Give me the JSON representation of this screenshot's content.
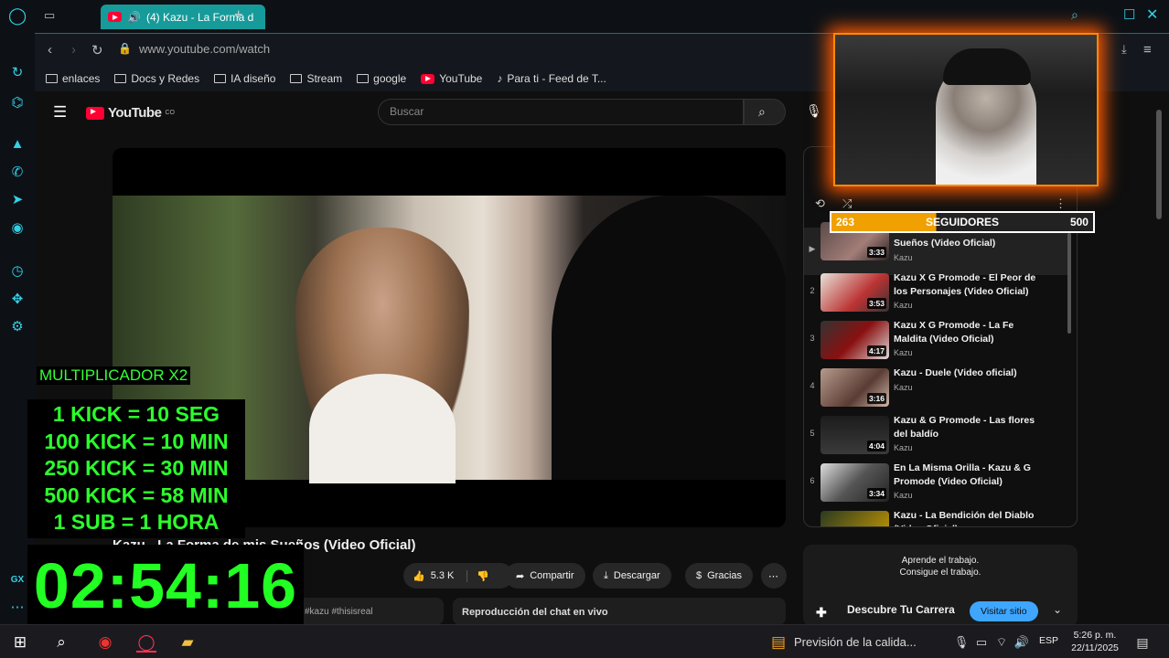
{
  "browser": {
    "tab": {
      "title": "(4) Kazu - La Forma d"
    },
    "url": "www.youtube.com/watch",
    "bookmarks": [
      {
        "label": "enlaces",
        "icon": "folder-icon"
      },
      {
        "label": "Docs y Redes",
        "icon": "folder-icon"
      },
      {
        "label": "IA diseño",
        "icon": "folder-icon"
      },
      {
        "label": "Stream",
        "icon": "folder-icon"
      },
      {
        "label": "google",
        "icon": "folder-icon"
      },
      {
        "label": "YouTube",
        "icon": "youtube-icon"
      },
      {
        "label": "Para ti - Feed de T...",
        "icon": "tiktok-icon"
      }
    ]
  },
  "youtube": {
    "logo_text": "YouTube",
    "logo_suffix": "CO",
    "search_placeholder": "Buscar",
    "video_title": "Kazu - La Forma de mis Sueños (Video Oficial)",
    "likes": "5.3 K",
    "share_label": "Compartir",
    "download_label": "Descargar",
    "thanks_label": "Gracias",
    "description_tags": "#kazu #thisisreal",
    "chat_label": "Reproducción del chat en vivo",
    "playlist": [
      {
        "num": "▶",
        "title": "Sueños (Video Oficial)",
        "channel": "Kazu",
        "duration": "3:33"
      },
      {
        "num": "2",
        "title": "Kazu X G Promode - El Peor de los Personajes (Video Oficial)",
        "channel": "Kazu",
        "duration": "3:53"
      },
      {
        "num": "3",
        "title": "Kazu X G Promode - La Fe Maldita (Video Oficial)",
        "channel": "Kazu",
        "duration": "4:17"
      },
      {
        "num": "4",
        "title": "Kazu - Duele (Video oficial)",
        "channel": "Kazu",
        "duration": "3:16"
      },
      {
        "num": "5",
        "title": "Kazu & G Promode - Las flores del baldío",
        "channel": "Kazu",
        "duration": "4:04"
      },
      {
        "num": "6",
        "title": "En La Misma Orilla - Kazu & G Promode (Video Oficial)",
        "channel": "Kazu",
        "duration": "3:34"
      },
      {
        "num": "",
        "title": "Kazu - La Bendición del Diablo (Video Oficial)",
        "channel": "",
        "duration": ""
      }
    ],
    "ad": {
      "line1": "Aprende el trabajo.",
      "line2": "Consigue el trabajo.",
      "title": "Descubre Tu Carrera",
      "button": "Visitar sitio"
    }
  },
  "overlay": {
    "followers_current": "263",
    "followers_label": "SEGUIDORES",
    "followers_goal": "500",
    "multiplier": "MULTIPLICADOR X2",
    "kick_rules": [
      "1 KICK = 10 SEG",
      "100  KICK = 10 MIN",
      "250 KICK = 30 MIN",
      "500 KICK = 58 MIN",
      "1 SUB = 1 HORA"
    ],
    "timer": "02:54:16"
  },
  "taskbar": {
    "news": "Previsión de la calida...",
    "language": "ESP",
    "time": "5:26 p. m.",
    "date": "22/11/2025"
  }
}
